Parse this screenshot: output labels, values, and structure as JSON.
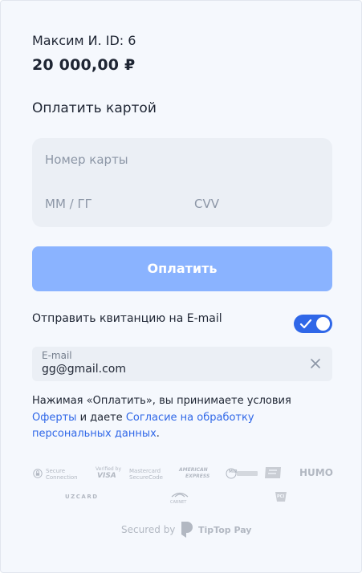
{
  "payee": "Максим И. ID: 6",
  "amount": "20 000,00 ₽",
  "section_title": "Оплатить картой",
  "card": {
    "number_placeholder": "Номер карты",
    "expiry_placeholder": "ММ / ГГ",
    "cvv_placeholder": "CVV"
  },
  "pay_button": "Оплатить",
  "receipt": {
    "label": "Отправить квитанцию на E-mail",
    "enabled": true,
    "email_label": "E-mail",
    "email_value": "gg@gmail.com"
  },
  "terms": {
    "part1": "Нажимая «Оплатить», вы принимаете условия",
    "link1": "Оферты",
    "part2": " и даете ",
    "link2": "Согласие на обработку персональных данных",
    "part3": "."
  },
  "badges": {
    "secure": [
      "Secure",
      "Connection"
    ],
    "visa": [
      "Verified by",
      "VISA"
    ],
    "mastercard": [
      "Mastercard",
      "SecureCode"
    ],
    "amex": [
      "AMERICAN",
      "EXPRESS"
    ],
    "mir": "MIR",
    "humo": "HUMO",
    "uzcard": "UZCARD",
    "carnet": "CARNET",
    "pci": "PCI DSS"
  },
  "footer": {
    "secured_by": "Secured by",
    "brand": "TipTop Pay"
  },
  "colors": {
    "accent": "#2f67e8",
    "button_disabled": "#8ab3ff",
    "field_bg": "#ebeff5",
    "page_bg": "#f5f8fd"
  }
}
